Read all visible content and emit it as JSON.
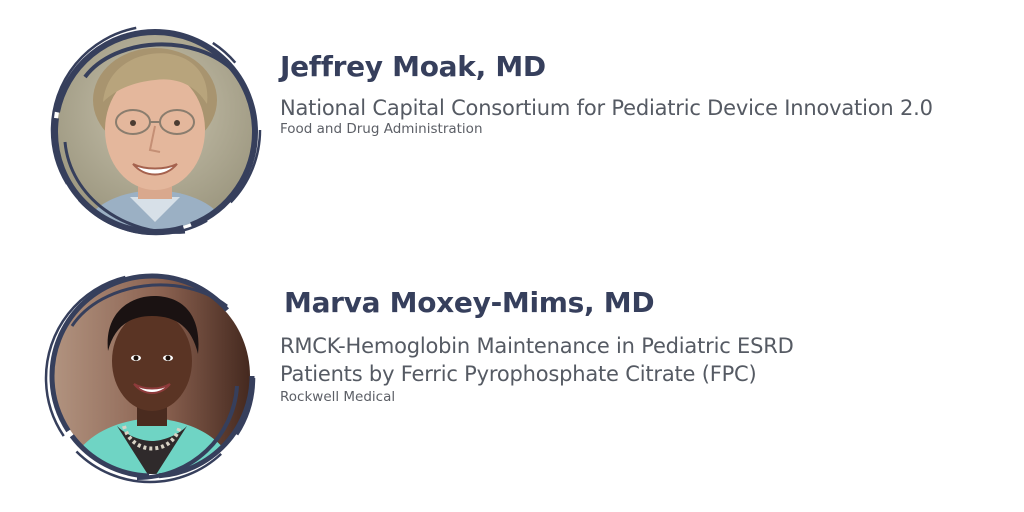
{
  "colors": {
    "accent": "#363f5c",
    "text": "#555a63",
    "background": "#ffffff"
  },
  "speakers": [
    {
      "name": "Jeffrey Moak, MD",
      "project": "National Capital Consortium for Pediatric Device Innovation 2.0",
      "organization": "Food and Drug Administration",
      "photo": "headshot-man-glasses"
    },
    {
      "name": "Marva Moxey-Mims, MD",
      "project_lines": [
        "RMCK-Hemoglobin Maintenance in Pediatric ESRD",
        "Patients by Ferric Pyrophosphate Citrate (FPC)"
      ],
      "organization": "Rockwell Medical",
      "photo": "headshot-woman-teal-jacket"
    }
  ]
}
